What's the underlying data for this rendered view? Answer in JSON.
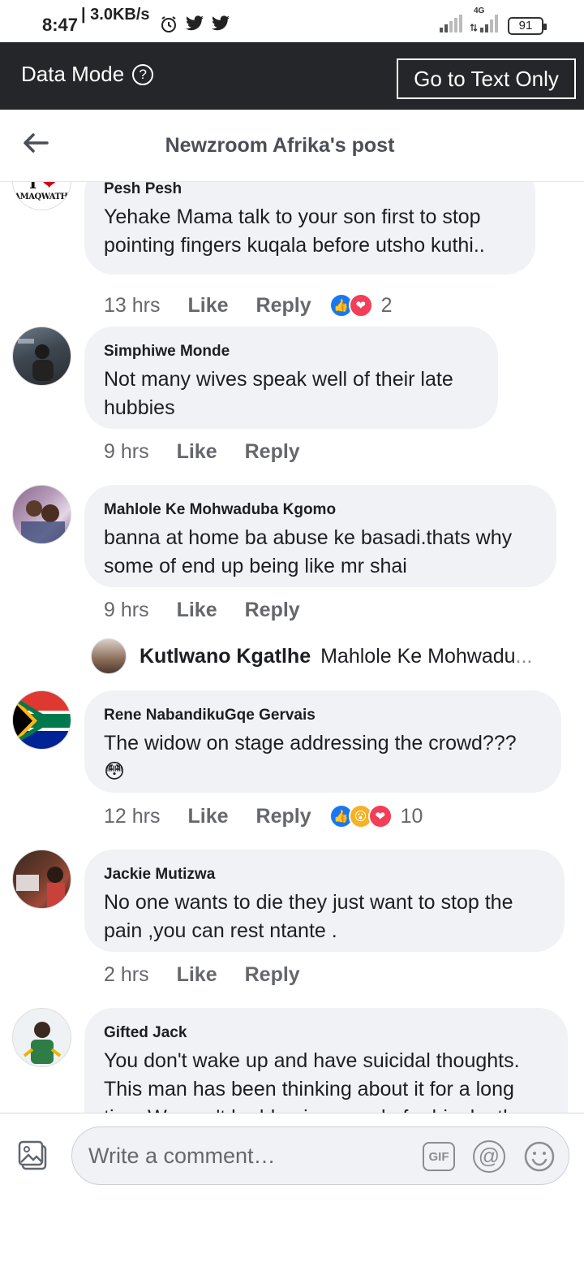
{
  "status_bar": {
    "time": "8:47",
    "speed": "| 3.0KB/s",
    "network_label": "4G",
    "battery": "91"
  },
  "data_mode_bar": {
    "label": "Data Mode",
    "help_symbol": "?",
    "text_only_button": "Go to Text Only"
  },
  "header": {
    "title": "Newzroom Afrika's post"
  },
  "comments": [
    {
      "author": "Pesh Pesh",
      "text": "Yehake Mama talk to your son first to stop pointing fingers kuqala before utsho kuthi..",
      "time": "13 hrs",
      "like": "Like",
      "reply": "Reply",
      "reaction_count": "2",
      "reactions": [
        "like-icon",
        "love-icon"
      ],
      "avatar_text_top": "I",
      "avatar_text_bottom": "AMAQWATHI"
    },
    {
      "author": "Simphiwe Monde",
      "text": "Not many wives speak well of their late hubbies",
      "time": "9 hrs",
      "like": "Like",
      "reply": "Reply"
    },
    {
      "author": "Mahlole Ke Mohwaduba Kgomo",
      "text": "banna at home ba abuse ke basadi.thats why some of end up being like mr shai",
      "time": "9 hrs",
      "like": "Like",
      "reply": "Reply",
      "reply_preview": {
        "author": "Kutlwano Kgatlhe",
        "snippet": "Mahlole Ke Mohwadu",
        "ellipsis": "..."
      }
    },
    {
      "author": "Rene NabandikuGqe Gervais",
      "text": "The widow on stage addressing the crowd???",
      "emoji": "😳",
      "time": "12 hrs",
      "like": "Like",
      "reply": "Reply",
      "reaction_count": "10",
      "reactions": [
        "like-icon",
        "wow-icon",
        "love-icon"
      ]
    },
    {
      "author": "Jackie Mutizwa",
      "text": "No one wants to die they just want to stop the pain ,you can rest ntante .",
      "time": "2 hrs",
      "like": "Like",
      "reply": "Reply"
    },
    {
      "author": "Gifted Jack",
      "text": "You don't wake up and have suicidal thoughts. This man has been thinking about it for a long time.We can't be blaming people for his death"
    }
  ],
  "composer": {
    "placeholder": "Write a comment…",
    "gif_label": "GIF",
    "at_symbol": "@"
  },
  "colors": {
    "data_bar_bg": "#242629",
    "bubble_bg": "#f0f2f5",
    "like_blue": "#1877f2",
    "love_red": "#f33e58",
    "wow_yellow": "#f7b125"
  }
}
